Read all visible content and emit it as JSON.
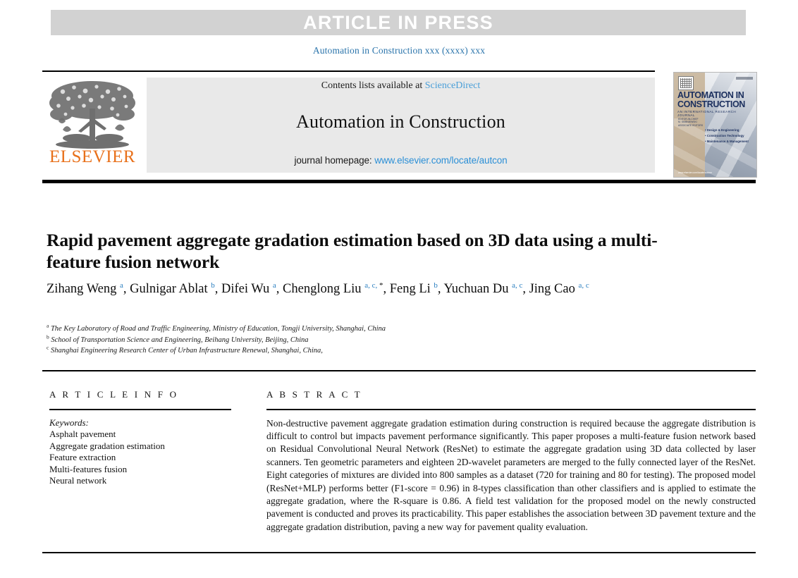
{
  "banner": {
    "text": "ARTICLE IN PRESS",
    "background_color": "#d2d2d2",
    "text_color": "#ffffff"
  },
  "citation": {
    "text": "Automation in Construction xxx (xxxx) xxx",
    "color": "#2a74ab"
  },
  "masthead": {
    "publisher_logo_label": "ELSEVIER",
    "publisher_logo_color": "#e8701a",
    "contents_prefix": "Contents lists available at ",
    "contents_link": "ScienceDirect",
    "contents_link_color": "#4a9fd8",
    "journal_title": "Automation in Construction",
    "homepage_prefix": "journal homepage: ",
    "homepage_link": "www.elsevier.com/locate/autcon",
    "homepage_link_color": "#2b8fd6",
    "grey_box_color": "#e9e9e9"
  },
  "cover": {
    "title_line1": "AUTOMATION IN",
    "title_line2": "CONSTRUCTION",
    "subtitle": "AN INTERNATIONAL RESEARCH JOURNAL",
    "meta": "EDITOR-IN-CHIEF\nM. SKIBNIEWSKI\nASSOCIATE EDITORS",
    "bullets": [
      "Design & Engineering",
      "Construction Technology",
      "Maintenance & Management"
    ],
    "url": "www.elsevier.com/locate/autcon",
    "title_color": "#1b2f5e"
  },
  "paper": {
    "title": "Rapid pavement aggregate gradation estimation based on 3D data using a multi-feature fusion network",
    "authors": [
      {
        "name": "Zihang Weng",
        "marks": "a",
        "separator": ", "
      },
      {
        "name": "Gulnigar Ablat",
        "marks": "b",
        "separator": ", "
      },
      {
        "name": "Difei Wu",
        "marks": "a",
        "separator": ", "
      },
      {
        "name": "Chenglong Liu",
        "marks": "a, c,",
        "star": "*",
        "separator": ", "
      },
      {
        "name": "Feng Li",
        "marks": "b",
        "separator": ", "
      },
      {
        "name": "Yuchuan Du",
        "marks": "a, c",
        "separator": ", "
      },
      {
        "name": "Jing Cao",
        "marks": "a, c",
        "separator": ""
      }
    ],
    "affiliations": [
      {
        "mark": "a",
        "text": "The Key Laboratory of Road and Traffic Engineering, Ministry of Education, Tongji University, Shanghai, China"
      },
      {
        "mark": "b",
        "text": "School of Transportation Science and Engineering, Beihang University, Beijing, China"
      },
      {
        "mark": "c",
        "text": "Shanghai Engineering Research Center of Urban Infrastructure Renewal, Shanghai, China,"
      }
    ]
  },
  "article_info": {
    "heading": "A R T I C L E  I N F O",
    "keywords_label": "Keywords:",
    "keywords": [
      "Asphalt pavement",
      "Aggregate gradation estimation",
      "Feature extraction",
      "Multi-features fusion",
      "Neural network"
    ]
  },
  "abstract": {
    "heading": "A B S T R A C T",
    "text": "Non-destructive pavement aggregate gradation estimation during construction is required because the aggregate distribution is difficult to control but impacts pavement performance significantly. This paper proposes a multi-feature fusion network based on Residual Convolutional Neural Network (ResNet) to estimate the aggregate gradation using 3D data collected by laser scanners. Ten geometric parameters and eighteen 2D-wavelet parameters are merged to the fully connected layer of the ResNet. Eight categories of mixtures are divided into 800 samples as a dataset (720 for training and 80 for testing). The proposed model (ResNet+MLP) performs better (F1-score = 0.96) in 8-types classification than other classifiers and is applied to estimate the aggregate gradation, where the R-square is 0.86. A field test validation for the proposed model on the newly constructed pavement is conducted and proves its practicability. This paper establishes the association between 3D pavement texture and the aggregate gradation distribution, paving a new way for pavement quality evaluation."
  }
}
